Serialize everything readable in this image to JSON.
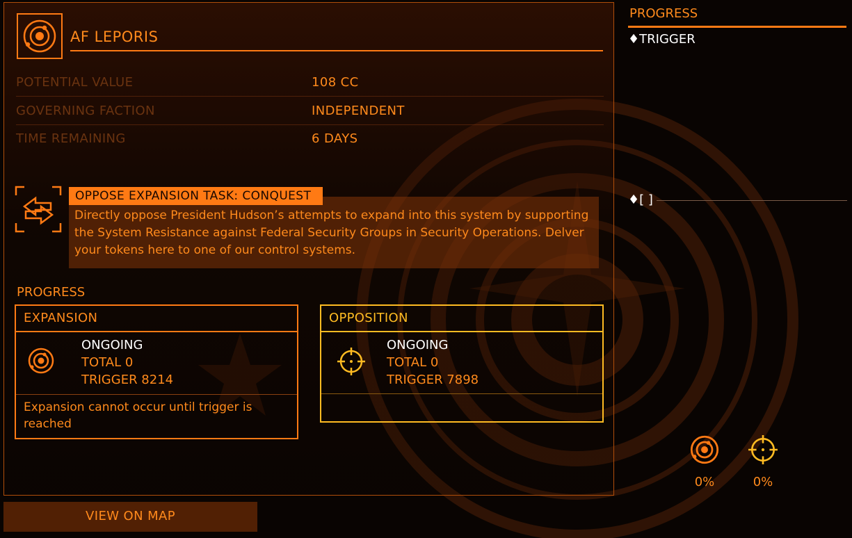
{
  "system": {
    "name": "AF LEPORIS",
    "icon": "system-orbit-icon"
  },
  "info": [
    {
      "label": "POTENTIAL VALUE",
      "value": "108 CC"
    },
    {
      "label": "GOVERNING FACTION",
      "value": "INDEPENDENT"
    },
    {
      "label": "TIME REMAINING",
      "value": "6 DAYS"
    }
  ],
  "task": {
    "icon": "exchange-arrows-icon",
    "title": "OPPOSE EXPANSION TASK: CONQUEST",
    "description": "Directly oppose President Hudson’s attempts to expand into this system by supporting the System Resistance against Federal Security Groups in Security Operations. Delver your tokens here to one of our control systems."
  },
  "progress": {
    "heading": "PROGRESS",
    "expansion": {
      "title": "EXPANSION",
      "status": "ONGOING",
      "total": "TOTAL 0",
      "trigger": "TRIGGER 8214",
      "note": "Expansion cannot occur until trigger is reached"
    },
    "opposition": {
      "title": "OPPOSITION",
      "status": "ONGOING",
      "total": "TOTAL 0",
      "trigger": "TRIGGER 7898"
    }
  },
  "view_map_button": "VIEW ON MAP",
  "side": {
    "heading": "PROGRESS",
    "trigger_label": "TRIGGER",
    "marker_label": "[ ]",
    "expansion_pct": "0%",
    "opposition_pct": "0%"
  },
  "colors": {
    "accent": "#ff7a14",
    "opposition_accent": "#ffbb22",
    "background": "#090402"
  }
}
